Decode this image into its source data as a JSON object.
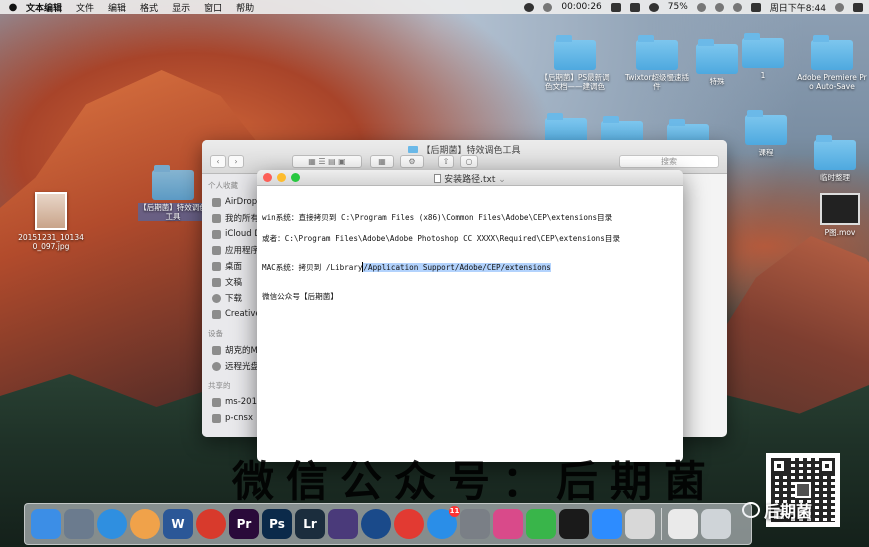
{
  "menubar": {
    "apple": "",
    "items": [
      "文本编辑",
      "文件",
      "编辑",
      "格式",
      "显示",
      "窗口",
      "帮助"
    ],
    "timer": "00:00:26",
    "battery": "75%",
    "clock": "周日下午8:44"
  },
  "desktop": {
    "left_file_label": "20151231_101340_097.jpg",
    "dragged_folder_label": "【后期菌】特效调色工具",
    "icons": [
      {
        "label": "【后期菌】PS最新调色文档——建调色"
      },
      {
        "label": "Twixtor超级慢速插件"
      },
      {
        "label": "特殊"
      },
      {
        "label": "1"
      },
      {
        "label": "Adobe Premiere Pro Auto-Save"
      },
      {
        "label": ""
      },
      {
        "label": ""
      },
      {
        "label": ""
      },
      {
        "label": "课程"
      },
      {
        "label": "临时整理"
      },
      {
        "label": "P图.mov"
      }
    ]
  },
  "finder": {
    "title": "【后期菌】特效调色工具",
    "search_placeholder": "搜索",
    "favorites_header": "个人收藏",
    "favorites": [
      "AirDrop",
      "我的所有文件",
      "iCloud Drive",
      "应用程序",
      "桌面",
      "文稿",
      "下载",
      "Creative Cloud Files"
    ],
    "devices_header": "设备",
    "devices": [
      "胡克的MacBook",
      "远程光盘"
    ],
    "shared_header": "共享的",
    "shared": [
      "ms-2018",
      "p-cnsx"
    ]
  },
  "editor": {
    "title": "安装路径.txt",
    "lines": {
      "win": "win系统：直接拷贝到  C:\\Program Files (x86)\\Common Files\\Adobe\\CEP\\extensions目录",
      "or": "或者：C:\\Program Files\\Adobe\\Adobe Photoshop CC XXXX\\Required\\CEP\\extensions目录",
      "mac_prefix": "MAC系统：拷贝到  /Library",
      "mac_selected": "/Application Support/Adobe/CEP/extensions",
      "wechat": "微信公众号【后期菌】"
    }
  },
  "watermark": {
    "text": "微信公众号：后期菌",
    "logo_text": "后期菌"
  },
  "dock": {
    "badge_appstore": "11",
    "apps": [
      {
        "name": "finder-icon",
        "color": "#3c8ee6",
        "glyph": ""
      },
      {
        "name": "launchpad-icon",
        "color": "#6b7b8e",
        "glyph": ""
      },
      {
        "name": "safari-icon",
        "color": "#2f8fe0",
        "glyph": ""
      },
      {
        "name": "photos-icon",
        "color": "#f0a24a",
        "glyph": ""
      },
      {
        "name": "word-icon",
        "color": "#2b5797",
        "glyph": "W"
      },
      {
        "name": "screen-recorder-icon",
        "color": "#d83a2c",
        "glyph": ""
      },
      {
        "name": "premiere-icon",
        "color": "#2a0a3a",
        "glyph": "Pr"
      },
      {
        "name": "photoshop-icon",
        "color": "#0b2a4a",
        "glyph": "Ps"
      },
      {
        "name": "lightroom-icon",
        "color": "#1b2d3d",
        "glyph": "Lr"
      },
      {
        "name": "final-cut-icon",
        "color": "#4a3a7a",
        "glyph": ""
      },
      {
        "name": "quicktime-icon",
        "color": "#1a4a8a",
        "glyph": ""
      },
      {
        "name": "netease-music-icon",
        "color": "#e23a32",
        "glyph": ""
      },
      {
        "name": "app-store-icon",
        "color": "#2a8ee8",
        "glyph": ""
      },
      {
        "name": "system-preferences-icon",
        "color": "#7a7f86",
        "glyph": ""
      },
      {
        "name": "screen-sharing-icon",
        "color": "#d94a8a",
        "glyph": ""
      },
      {
        "name": "wechat-mac-icon",
        "color": "#39b54a",
        "glyph": ""
      },
      {
        "name": "qq-icon",
        "color": "#1a1a1a",
        "glyph": ""
      },
      {
        "name": "zoom-icon",
        "color": "#2d8cff",
        "glyph": ""
      },
      {
        "name": "preview-icon",
        "color": "#d8d8d8",
        "glyph": ""
      },
      {
        "name": "downloads-stack-icon",
        "color": "#eaeaea",
        "glyph": ""
      },
      {
        "name": "trash-icon",
        "color": "#cfd4d8",
        "glyph": ""
      }
    ]
  }
}
